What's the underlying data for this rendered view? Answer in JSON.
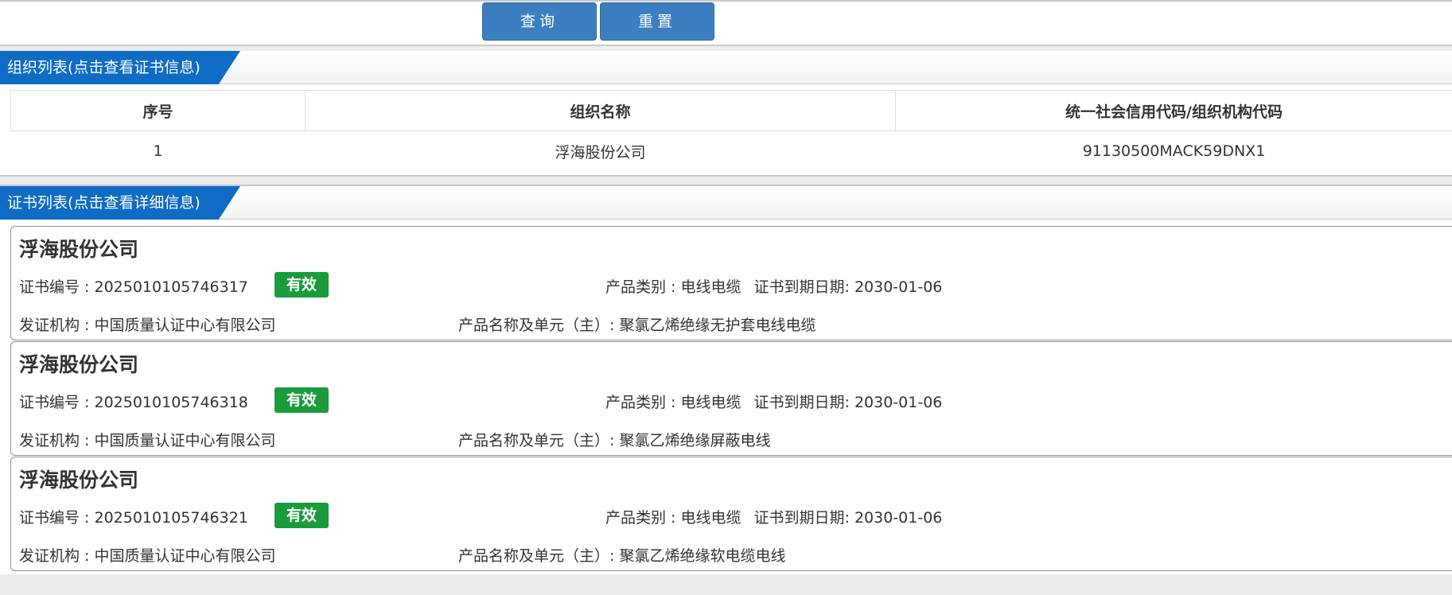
{
  "toolbar": {
    "query_label": "查询",
    "reset_label": "重置"
  },
  "org_section": {
    "title": "组织列表(点击查看证书信息)",
    "columns": [
      "序号",
      "组织名称",
      "统一社会信用代码/组织机构代码"
    ],
    "rows": [
      {
        "index": "1",
        "name": "浮海股份公司",
        "code": "91130500MACK59DNX1"
      }
    ]
  },
  "cert_section": {
    "title": "证书列表(点击查看详细信息)",
    "labels": {
      "cert_no": "证书编号 : ",
      "issuer": "发证机构 : ",
      "category": "产品类别 : ",
      "expiry": "证书到期日期: ",
      "product": "产品名称及单元（主）: "
    },
    "certs": [
      {
        "org": "浮海股份公司",
        "cert_no": "2025010105746317",
        "status": "有效",
        "category": "电线电缆",
        "expiry": "2030-01-06",
        "issuer": "中国质量认证中心有限公司",
        "product": "聚氯乙烯绝缘无护套电线电缆"
      },
      {
        "org": "浮海股份公司",
        "cert_no": "2025010105746318",
        "status": "有效",
        "category": "电线电缆",
        "expiry": "2030-01-06",
        "issuer": "中国质量认证中心有限公司",
        "product": "聚氯乙烯绝缘屏蔽电线"
      },
      {
        "org": "浮海股份公司",
        "cert_no": "2025010105746321",
        "status": "有效",
        "category": "电线电缆",
        "expiry": "2030-01-06",
        "issuer": "中国质量认证中心有限公司",
        "product": "聚氯乙烯绝缘软电缆电线"
      }
    ]
  },
  "colors": {
    "button": "#3c7fc1",
    "tab": "#0f6cc4",
    "valid_badge": "#1a9b3c"
  }
}
